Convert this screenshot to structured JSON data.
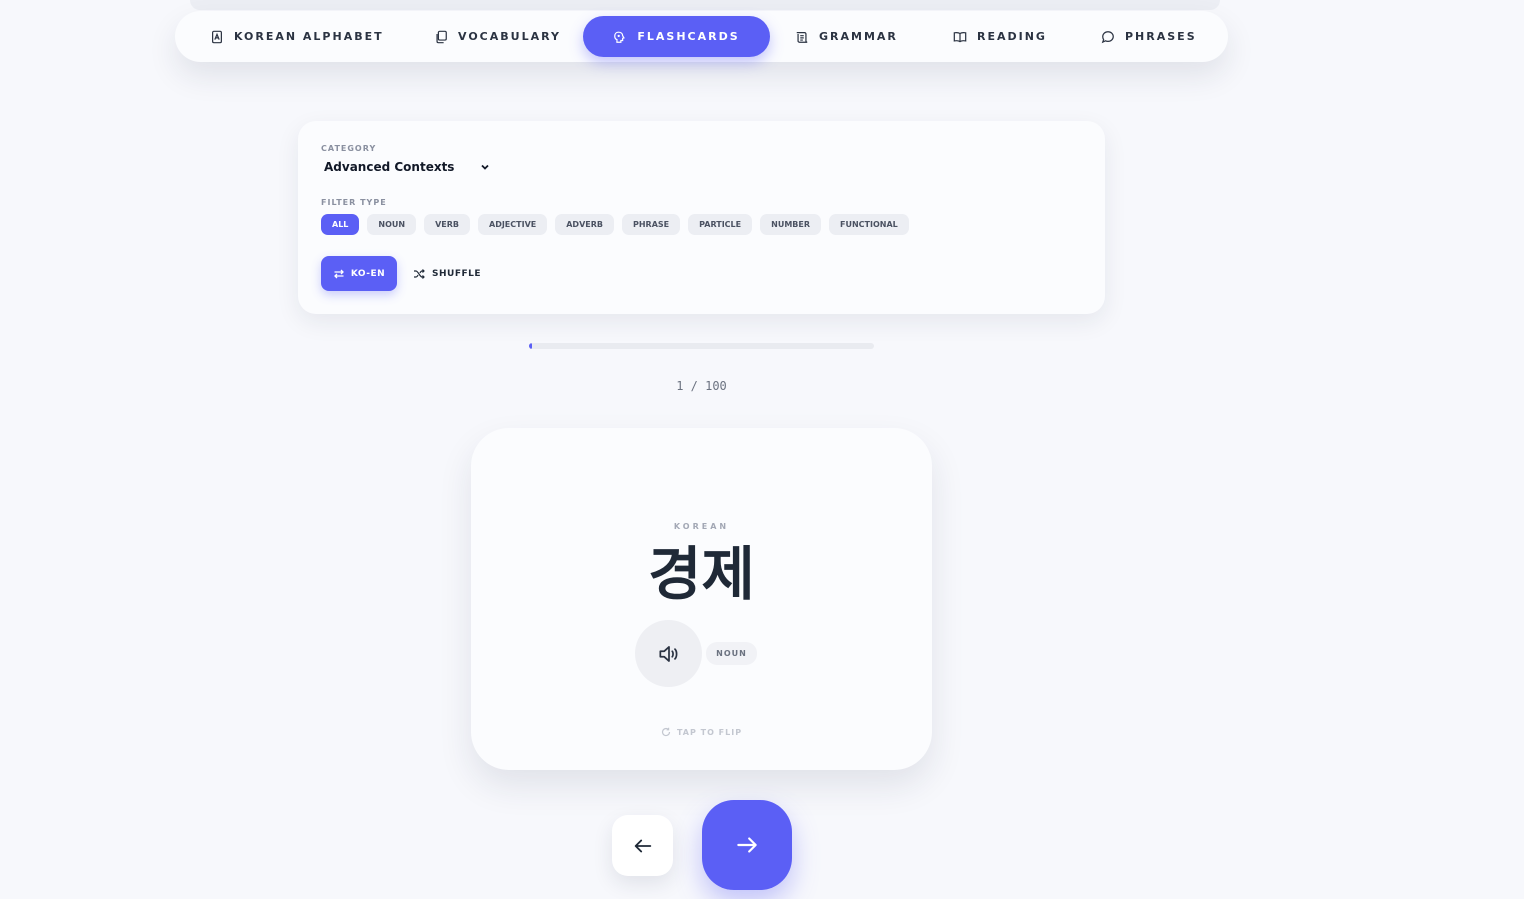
{
  "nav": {
    "items": [
      {
        "label": "KOREAN ALPHABET",
        "icon": "alphabet-icon"
      },
      {
        "label": "VOCABULARY",
        "icon": "vocabulary-icon"
      },
      {
        "label": "FLASHCARDS",
        "icon": "flashcards-icon",
        "active": true
      },
      {
        "label": "GRAMMAR",
        "icon": "grammar-icon"
      },
      {
        "label": "READING",
        "icon": "book-open-icon"
      },
      {
        "label": "PHRASES",
        "icon": "chat-bubble-icon"
      }
    ]
  },
  "settings": {
    "category_label": "CATEGORY",
    "category_value": "Advanced Contexts",
    "filter_label": "FILTER TYPE",
    "filters": [
      "ALL",
      "NOUN",
      "VERB",
      "ADJECTIVE",
      "ADVERB",
      "PHRASE",
      "PARTICLE",
      "NUMBER",
      "FUNCTIONAL"
    ],
    "active_filter": "ALL",
    "mode_label": "KO-EN",
    "shuffle_label": "SHUFFLE"
  },
  "progress": {
    "current": 1,
    "total": 100,
    "counter_text": "1 / 100",
    "fraction": 0.01
  },
  "card": {
    "language_label": "KOREAN",
    "word": "경제",
    "part_of_speech": "NOUN",
    "flip_hint": "TAP TO FLIP"
  },
  "colors": {
    "accent": "#5b5ff5",
    "background": "#f7f8fc",
    "surface": "#fbfcfe",
    "text": "#1f2937"
  }
}
